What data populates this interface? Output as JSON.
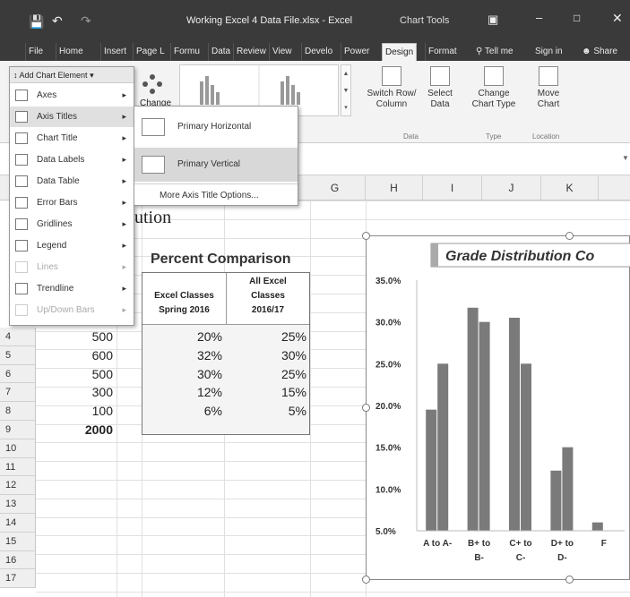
{
  "window": {
    "title": "Working Excel 4 Data File.xlsx - Excel",
    "context": "Chart Tools",
    "tell_me": "Tell me",
    "sign_in": "Sign in",
    "share": "Share"
  },
  "tabs": [
    "File",
    "Home",
    "Insert",
    "Page L",
    "Formu",
    "Data",
    "Review",
    "View",
    "Develo",
    "Power",
    "Design",
    "Format"
  ],
  "active_tab": "Design",
  "ribbon": {
    "add_chart_element": "Add Chart Element",
    "change_partial": "Change",
    "switch_row_col": [
      "Switch Row/",
      "Column"
    ],
    "select_data": [
      "Select",
      "Data"
    ],
    "change_chart_type": [
      "Change",
      "Chart Type"
    ],
    "move_chart": [
      "Move",
      "Chart"
    ],
    "groups": {
      "data": "Data",
      "type": "Type",
      "location": "Location"
    }
  },
  "menu": {
    "items": [
      {
        "label": "Axes",
        "icon": "axes-icon",
        "enabled": true
      },
      {
        "label": "Axis Titles",
        "icon": "axis-titles-icon",
        "enabled": true,
        "selected": true
      },
      {
        "label": "Chart Title",
        "icon": "chart-title-icon",
        "enabled": true
      },
      {
        "label": "Data Labels",
        "icon": "data-labels-icon",
        "enabled": true
      },
      {
        "label": "Data Table",
        "icon": "data-table-icon",
        "enabled": true
      },
      {
        "label": "Error Bars",
        "icon": "error-bars-icon",
        "enabled": true
      },
      {
        "label": "Gridlines",
        "icon": "gridlines-icon",
        "enabled": true
      },
      {
        "label": "Legend",
        "icon": "legend-icon",
        "enabled": true
      },
      {
        "label": "Lines",
        "icon": "lines-icon",
        "enabled": false
      },
      {
        "label": "Trendline",
        "icon": "trendline-icon",
        "enabled": true
      },
      {
        "label": "Up/Down Bars",
        "icon": "updown-bars-icon",
        "enabled": false
      }
    ],
    "submenu": {
      "items": [
        "Primary Horizontal",
        "Primary Vertical"
      ],
      "selected": "Primary Vertical",
      "more": "More Axis Title Options..."
    }
  },
  "columns": [
    "G",
    "H",
    "I",
    "J",
    "K"
  ],
  "rows": [
    "4",
    "5",
    "6",
    "7",
    "8",
    "9",
    "10",
    "11",
    "12",
    "13",
    "14",
    "15",
    "16",
    "17"
  ],
  "sheet": {
    "partial_title": "ution",
    "table_title": "Percent Comparison",
    "header1": [
      "Excel Classes",
      "Spring 2016"
    ],
    "header2": [
      "All Excel",
      "Classes",
      "2016/17"
    ],
    "counts": [
      "500",
      "600",
      "500",
      "300",
      "100",
      "2000"
    ],
    "pct_spring": [
      "20%",
      "32%",
      "30%",
      "12%",
      "6%"
    ],
    "pct_all": [
      "25%",
      "30%",
      "25%",
      "15%",
      "5%"
    ]
  },
  "chart_data": {
    "type": "bar",
    "title": "Grade Distribution Co",
    "categories": [
      "A to A-",
      "B+ to B-",
      "C+ to C-",
      "D+ to D-",
      "F"
    ],
    "series": [
      {
        "values": [
          0.195,
          0.317,
          0.305,
          0.122,
          0.06
        ]
      },
      {
        "values": [
          0.25,
          0.3,
          0.25,
          0.15,
          0.05
        ]
      }
    ],
    "y_ticks": [
      "35.0%",
      "30.0%",
      "25.0%",
      "20.0%",
      "15.0%",
      "10.0%",
      "5.0%"
    ],
    "ylim": [
      0.05,
      0.35
    ],
    "colors": {
      "bar": "#7a7a7a"
    }
  }
}
